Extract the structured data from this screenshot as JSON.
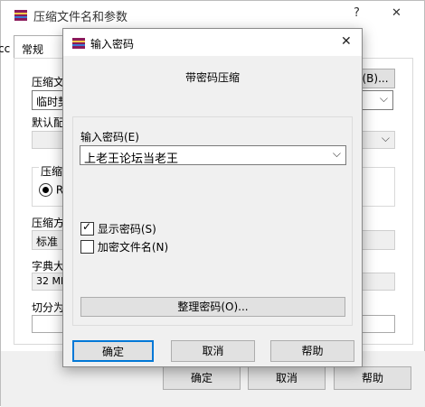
{
  "bg": {
    "title": "压缩文件名和参数",
    "help_glyph": "?",
    "close_glyph": "✕",
    "left_cut": "cc",
    "tabs": [
      "常规"
    ],
    "label_archive": "压缩文",
    "archive_value": "临时契",
    "browse": "(B)...",
    "label_default": "默认配",
    "group_compress": "压缩",
    "radio_text": "RA",
    "label_method": "压缩方",
    "method_value": "标准",
    "label_dict": "字典大",
    "dict_value": "32 MB",
    "label_split": "切分为",
    "ok": "确定",
    "cancel": "取消",
    "help": "帮助"
  },
  "dlg": {
    "title": "输入密码",
    "close_glyph": "✕",
    "subtitle": "带密码压缩",
    "password_label": "输入密码(E)",
    "password_value": "上老王论坛当老王",
    "show_password": "显示密码(S)",
    "encrypt_filenames": "加密文件名(N)",
    "show_password_checked": true,
    "encrypt_filenames_checked": false,
    "organize": "整理密码(O)...",
    "ok": "确定",
    "cancel": "取消",
    "help": "帮助"
  },
  "colors": {
    "accent": "#0078d7",
    "dialog_bg": "#f0f0f0",
    "winrar_icon": "#8b1a5a"
  }
}
